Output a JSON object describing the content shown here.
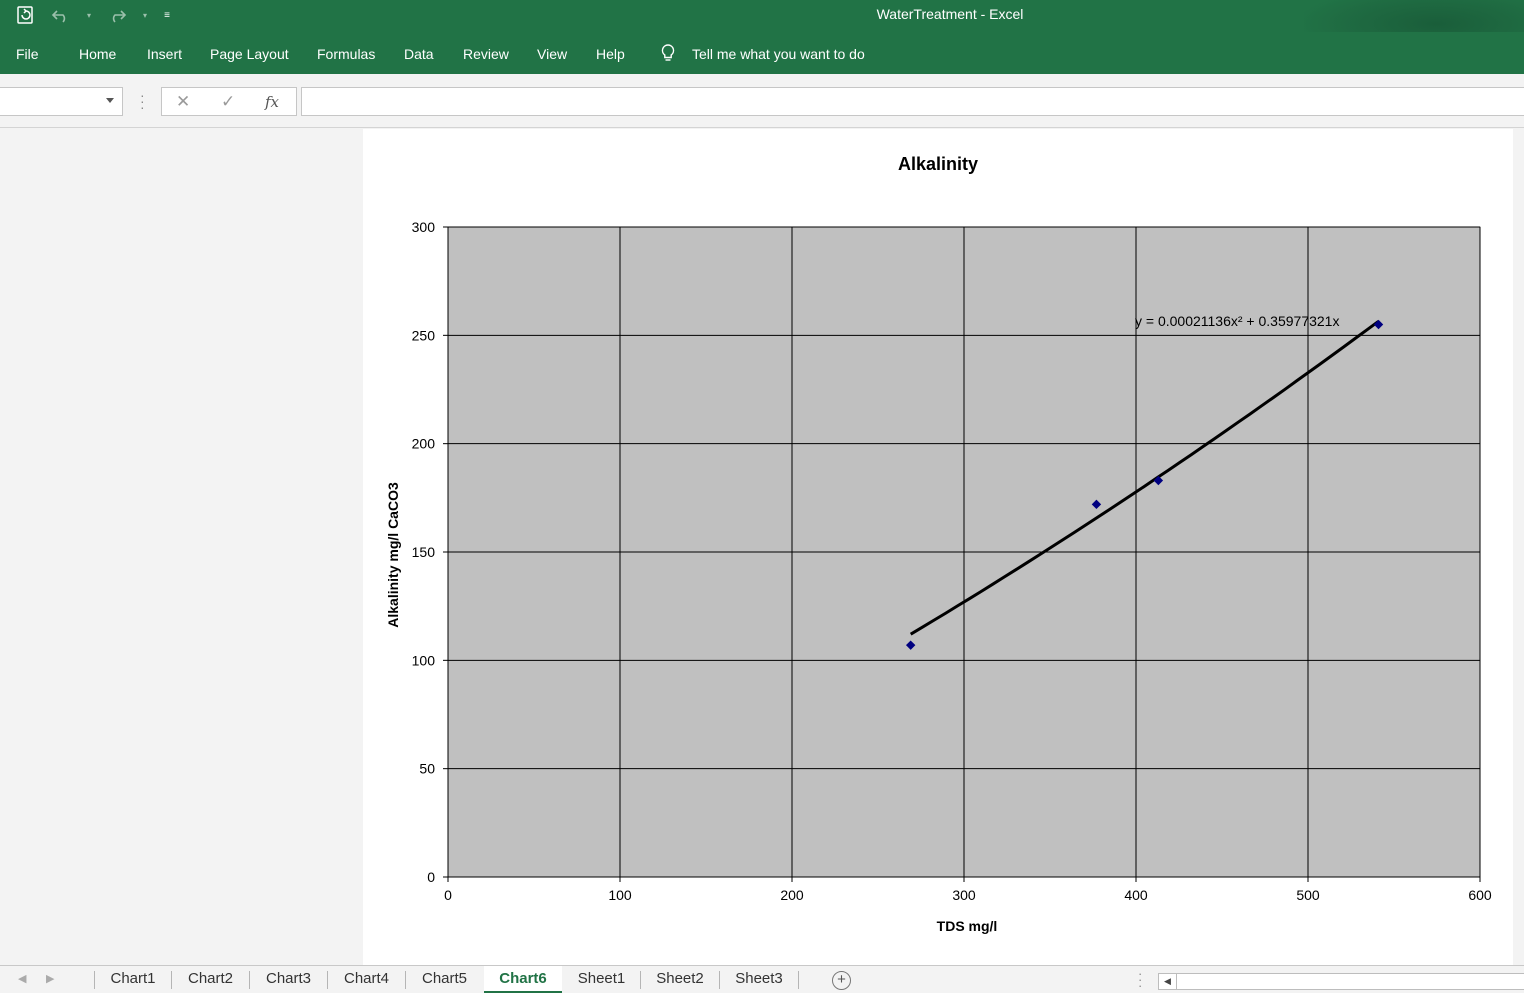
{
  "window": {
    "title": "WaterTreatment  -  Excel"
  },
  "ribbon": {
    "tabs": [
      "File",
      "Home",
      "Insert",
      "Page Layout",
      "Formulas",
      "Data",
      "Review",
      "View",
      "Help"
    ],
    "tell_me": "Tell me what you want to do"
  },
  "formula_bar": {
    "name_box": "",
    "formula": "",
    "fx_label": "fx"
  },
  "chart_data": {
    "type": "scatter",
    "title": "Alkalinity",
    "xlabel": "TDS mg/l",
    "ylabel": "Alkalinity mg/l CaCO3",
    "xlim": [
      0,
      600
    ],
    "ylim": [
      0,
      300
    ],
    "x_ticks": [
      0,
      100,
      200,
      300,
      400,
      500,
      600
    ],
    "y_ticks": [
      0,
      50,
      100,
      150,
      200,
      250,
      300
    ],
    "grid": true,
    "plot_background": "#c0c0c0",
    "marker_color": "#000080",
    "series": [
      {
        "x": [
          269,
          377,
          413,
          541
        ],
        "y": [
          107,
          172,
          183,
          255
        ]
      }
    ],
    "trendline": {
      "type": "polynomial",
      "a2": 0.00021136,
      "a1": 0.35977321,
      "x_range": [
        269,
        541
      ],
      "equation_label": "y = 0.00021136x² + 0.35977321x"
    }
  },
  "sheet_tabs": [
    "Chart1",
    "Chart2",
    "Chart3",
    "Chart4",
    "Chart5",
    "Chart6",
    "Sheet1",
    "Sheet2",
    "Sheet3"
  ],
  "active_sheet": "Chart6"
}
